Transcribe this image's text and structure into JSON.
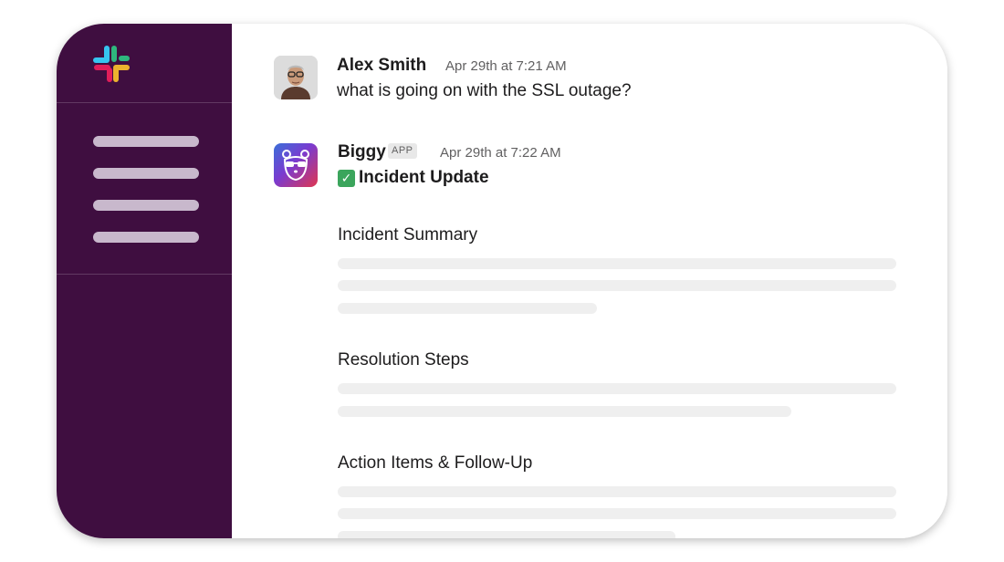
{
  "app": {
    "colors": {
      "sidebar": "#3f0e40",
      "sidebar_lines": "#c8b8cc",
      "placeholder": "#efefef",
      "check": "#3ba55c"
    }
  },
  "sidebar": {
    "logo_icon": "slack-logo-icon",
    "nav_item_count": 4
  },
  "messages": [
    {
      "author": "Alex Smith",
      "timestamp": "Apr 29th at 7:21 AM",
      "text": "what is going on with the SSL outage?",
      "avatar_icon": "user-photo-avatar"
    },
    {
      "author": "Biggy",
      "badge": "APP",
      "timestamp": "Apr 29th at 7:22 AM",
      "headline_icon": "✓",
      "headline": "Incident Update",
      "avatar_icon": "bear-glasses-app-icon",
      "sections": [
        {
          "title": "Incident Summary"
        },
        {
          "title": "Resolution Steps"
        },
        {
          "title": "Action Items & Follow-Up"
        }
      ]
    }
  ]
}
